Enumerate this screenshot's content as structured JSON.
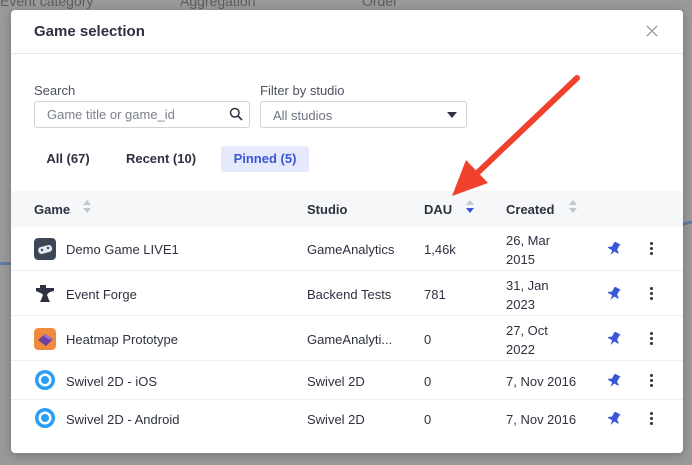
{
  "background": {
    "header_items": [
      "Event category",
      "Aggregation",
      "Order"
    ]
  },
  "modal": {
    "title": "Game selection",
    "close_icon": "close-icon",
    "search": {
      "label": "Search",
      "placeholder": "Game title or game_id"
    },
    "filter": {
      "label": "Filter by studio",
      "value": "All studios"
    },
    "tabs": [
      {
        "label": "All (67)",
        "active": false
      },
      {
        "label": "Recent (10)",
        "active": false
      },
      {
        "label": "Pinned (5)",
        "active": true
      }
    ],
    "table": {
      "columns": [
        "Game",
        "Studio",
        "DAU",
        "Created"
      ],
      "sorted_by": "DAU",
      "rows": [
        {
          "game": "Demo Game LIVE1",
          "studio": "GameAnalytics",
          "dau": "1,46k",
          "created_line1": "26, Mar",
          "created_line2": "2015",
          "icon": "controller-icon"
        },
        {
          "game": "Event Forge",
          "studio": "Backend Tests",
          "dau": "781",
          "created_line1": "31, Jan",
          "created_line2": "2023",
          "icon": "anvil-icon"
        },
        {
          "game": "Heatmap Prototype",
          "studio": "GameAnalyti...",
          "dau": "0",
          "created_line1": "27, Oct",
          "created_line2": "2022",
          "icon": "cube-icon"
        },
        {
          "game": "Swivel 2D - iOS",
          "studio": "Swivel 2D",
          "dau": "0",
          "created_line1": "7, Nov 2016",
          "created_line2": "",
          "icon": "swivel-icon"
        },
        {
          "game": "Swivel 2D - Android",
          "studio": "Swivel 2D",
          "dau": "0",
          "created_line1": "7, Nov 2016",
          "created_line2": "",
          "icon": "swivel-icon"
        }
      ]
    }
  },
  "colors": {
    "accent": "#3a55d6",
    "arrow": "#f0412c"
  }
}
